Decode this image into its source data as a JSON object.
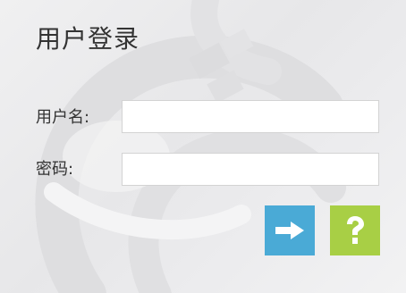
{
  "login_form": {
    "title": "用户登录",
    "username_label": "用户名:",
    "username_value": "",
    "password_label": "密码:",
    "password_value": ""
  },
  "actions": {
    "submit_icon": "arrow-right-icon",
    "help_icon": "question-mark-icon"
  },
  "colors": {
    "submit_button": "#4aaad6",
    "help_button": "#a8cf45",
    "background": "#ececee",
    "text": "#333333"
  }
}
